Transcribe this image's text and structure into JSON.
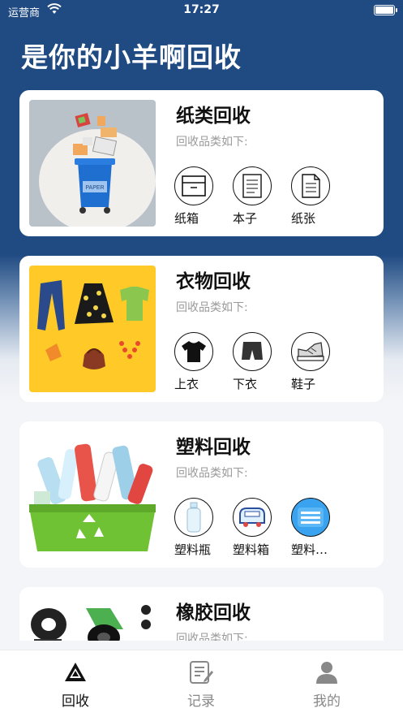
{
  "status_bar": {
    "carrier": "运营商",
    "time": "17:27"
  },
  "page": {
    "title": "是你的小羊啊回收"
  },
  "cards": [
    {
      "title": "纸类回收",
      "subtitle": "回收品类如下:",
      "thumb_icon": "paper-recycle-bin-image",
      "bin_label": "PAPER",
      "items": [
        {
          "label": "纸箱",
          "icon": "box-icon"
        },
        {
          "label": "本子",
          "icon": "notebook-icon"
        },
        {
          "label": "纸张",
          "icon": "paper-sheet-icon"
        }
      ]
    },
    {
      "title": "衣物回收",
      "subtitle": "回收品类如下:",
      "thumb_icon": "clothes-image",
      "items": [
        {
          "label": "上衣",
          "icon": "tshirt-icon"
        },
        {
          "label": "下衣",
          "icon": "shorts-icon"
        },
        {
          "label": "鞋子",
          "icon": "sneaker-icon"
        }
      ]
    },
    {
      "title": "塑料回收",
      "subtitle": "回收品类如下:",
      "thumb_icon": "plastic-bottles-basket-image",
      "items": [
        {
          "label": "塑料瓶",
          "icon": "plastic-bottle-icon"
        },
        {
          "label": "塑料箱",
          "icon": "plastic-crate-icon"
        },
        {
          "label": "塑料…",
          "icon": "plastic-basket-icon"
        }
      ]
    },
    {
      "title": "橡胶回收",
      "subtitle": "回收品类如下:",
      "thumb_icon": "rubber-tires-image",
      "items": []
    }
  ],
  "tabbar": [
    {
      "label": "回收",
      "icon": "recycle-triangle-icon",
      "active": true
    },
    {
      "label": "记录",
      "icon": "record-edit-icon",
      "active": false
    },
    {
      "label": "我的",
      "icon": "user-icon",
      "active": false
    }
  ],
  "colors": {
    "header_blue": "#1f4a82",
    "bin_blue": "#1f6fd0",
    "clothes_bg": "#ffc928",
    "basket_green": "#6fc233"
  }
}
